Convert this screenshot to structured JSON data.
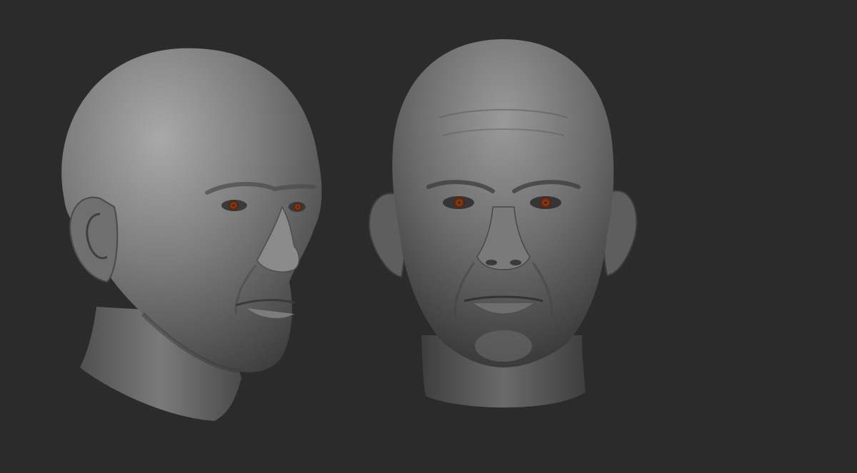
{
  "scene": {
    "background_color": "#2b2b2b",
    "render_style": "sculpt-viewport-matcap",
    "subjects": [
      {
        "id": "head-three-quarter",
        "view": "three-quarter-right",
        "material_color": "#7a7a7a",
        "iris_color": "#8a3c16"
      },
      {
        "id": "head-front",
        "view": "front",
        "material_color": "#6e6e6e",
        "iris_color": "#8a3c16"
      }
    ]
  }
}
